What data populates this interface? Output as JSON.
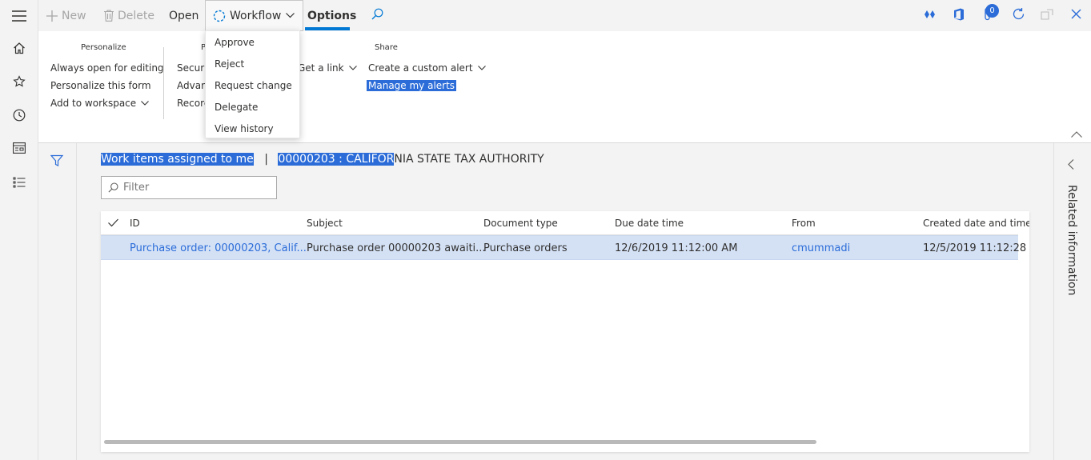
{
  "actionbar": {
    "new_label": "New",
    "delete_label": "Delete",
    "open_label": "Open",
    "workflow_label": "Workflow",
    "options_label": "Options",
    "badge_count": "0"
  },
  "ribbon": {
    "personalize": {
      "heading": "Personalize",
      "items": [
        "Always open for editing",
        "Personalize this form",
        "Add to workspace"
      ]
    },
    "page_options": {
      "heading": "P",
      "items": [
        "Securit",
        "Advanc",
        "Record"
      ]
    },
    "get_link_label": "Get a link",
    "share": {
      "heading": "Share",
      "create_alert_label": "Create a custom alert",
      "manage_alerts_label": "Manage my alerts"
    }
  },
  "workflow_menu": {
    "items": [
      "Approve",
      "Reject",
      "Request change",
      "Delegate",
      "View history"
    ]
  },
  "breadcrumb": {
    "part1": "Work items assigned to me",
    "separator": "|",
    "part2_selected": "00000203 : CALIFOR",
    "part2_rest": "NIA STATE TAX AUTHORITY"
  },
  "filter": {
    "placeholder": "Filter"
  },
  "grid": {
    "columns": [
      "ID",
      "Subject",
      "Document type",
      "Due date time",
      "From",
      "Created date and time"
    ],
    "rows": [
      {
        "id": "Purchase order: 00000203, Calif...",
        "subject": "Purchase order 00000203 awaiti...",
        "document_type": "Purchase orders",
        "due": "12/6/2019 11:12:00 AM",
        "from": "cmummadi",
        "created": "12/5/2019 11:12:28"
      }
    ]
  },
  "right_panel": {
    "label": "Related information"
  },
  "colors": {
    "accent": "#0078d4",
    "selection": "#2b6cd8",
    "row_selected": "#d4e1f5"
  }
}
